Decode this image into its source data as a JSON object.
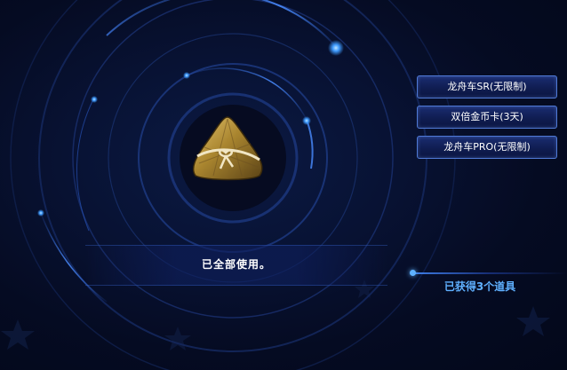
{
  "status": {
    "message": "已全部使用。"
  },
  "rewards": {
    "items": [
      {
        "label": "龙舟车SR(无限制)"
      },
      {
        "label": "双倍金币卡(3天)"
      },
      {
        "label": "龙舟车PRO(无限制)"
      }
    ],
    "obtained_text": "已获得3个道具"
  },
  "item_icon": "zongzi-icon",
  "colors": {
    "background": "#050b22",
    "ring_glow": "#3f8dff",
    "button_border": "#4f79d6",
    "obtained_text": "#5fb0ff"
  }
}
